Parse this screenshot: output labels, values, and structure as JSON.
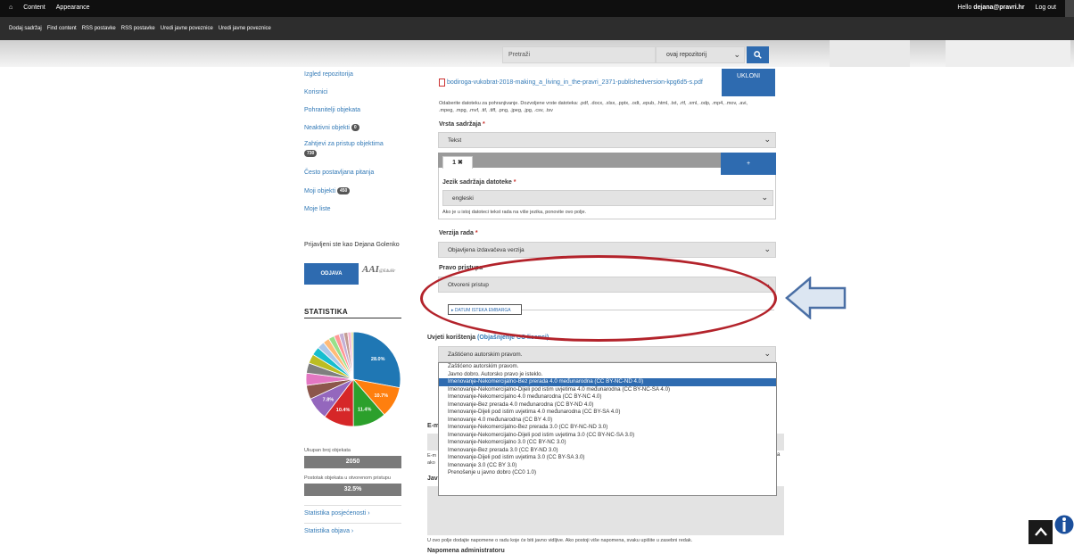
{
  "toolbar": {
    "content": "Content",
    "appearance": "Appearance",
    "hello": "Hello",
    "user": "dejana@pravri.hr",
    "logout": "Log out"
  },
  "shortcuts": [
    "Dodaj sadržaj",
    "Find content",
    "RSS postavke",
    "RSS postavke",
    "Uredi javne poveznice",
    "Uredi javne poveznice"
  ],
  "search": {
    "placeholder": "Pretraži",
    "scope": "ovaj repozitorij",
    "icon": "search-icon"
  },
  "sidebar": {
    "items": [
      {
        "label": "Izgled repozitorija"
      },
      {
        "label": "Korisnici"
      },
      {
        "label": "Pohranitelji objekata"
      },
      {
        "label": "Neaktivni objekti",
        "badge": "0"
      },
      {
        "label": "Zahtjevi za pristup objektima",
        "badge": "730"
      },
      {
        "label": "Često postavljana pitanja"
      },
      {
        "label": "Moji objekti",
        "badge": "450"
      },
      {
        "label": "Moje liste"
      }
    ],
    "logged_in": "Prijavljeni ste kao",
    "logged_user": "Dejana Golenko",
    "logout_button": "ODJAVA",
    "brand": "AAI",
    "brand_sub": "@EduHr"
  },
  "stats": {
    "title": "STATISTIKA",
    "total_label": "Ukupan broj objekata",
    "total_value": "2050",
    "open_label": "Postotak objekata u otvorenom pristupu",
    "open_value": "32.5%",
    "link_visits": "Statistika posjećenosti ›",
    "link_pubs": "Statistika objava ›"
  },
  "chart_data": {
    "type": "pie",
    "slices": [
      {
        "value": 28.0,
        "label": "28.0%",
        "color": "#1f77b4"
      },
      {
        "value": 10.7,
        "label": "10.7%",
        "color": "#ff7f0e"
      },
      {
        "value": 11.4,
        "label": "11.4%",
        "color": "#2ca02c"
      },
      {
        "value": 10.4,
        "label": "10.4%",
        "color": "#d62728"
      },
      {
        "value": 7.8,
        "label": "7.8%",
        "color": "#9467bd"
      },
      {
        "value": 4.8,
        "label": "",
        "color": "#8c564b"
      },
      {
        "value": 4.2,
        "label": "",
        "color": "#e377c2"
      },
      {
        "value": 3.5,
        "label": "",
        "color": "#7f7f7f"
      },
      {
        "value": 3.2,
        "label": "",
        "color": "#bcbd22"
      },
      {
        "value": 2.9,
        "label": "",
        "color": "#17becf"
      },
      {
        "value": 2.5,
        "label": "",
        "color": "#aec7e8"
      },
      {
        "value": 2.2,
        "label": "",
        "color": "#ffbb78"
      },
      {
        "value": 2.0,
        "label": "",
        "color": "#98df8a"
      },
      {
        "value": 1.8,
        "label": "",
        "color": "#ff9896"
      },
      {
        "value": 1.6,
        "label": "",
        "color": "#c5b0d5"
      },
      {
        "value": 1.4,
        "label": "",
        "color": "#c49c94"
      },
      {
        "value": 1.2,
        "label": "",
        "color": "#f7b6d2"
      },
      {
        "value": 0.7,
        "label": "",
        "color": "#dbdb8d"
      }
    ]
  },
  "form": {
    "file_name": "bodiroga-vukobrat-2018-making_a_living_in_the-pravri_2371-publishedversion-kpg6d5-s.pdf",
    "remove_button": "UKLONI",
    "file_help_1": "Odaberite datoteku za pohranjivanje. Dozvoljene vrste datoteka: .pdf, .docx, .xlsx, .pptx, .odt, .epub, .html, .txt, .rtf, .xml, .odp, .mp4, .mov, .avi,",
    "file_help_2": ".mpeg, .mpg, .mvf, .tif, .tiff, .png, .jpeg, .jpg, .csv, .tsv",
    "content_type_label": "Vrsta sadržaja",
    "content_type_value": "Tekst",
    "tab_label": "1",
    "add_tab": "+",
    "language_label": "Jezik sadržaja datoteke",
    "language_value": "engleski",
    "language_help": "Ako je u istoj datoteci tekst rada na više jezika, ponovite ovo polje.",
    "version_label": "Verzija rada",
    "version_value": "Objavljena izdavačeva verzija",
    "access_label": "Pravo pristupa",
    "access_value": "Otvoreni pristup",
    "embargo_button": "▸ DATUM ISTEKA EMBARGA",
    "terms_label": "Uvjeti korištenja",
    "terms_link": "(Objašnjenje CC licenci)",
    "terms_value": "Zaštićeno autorskim pravom.",
    "email_label": "E-m",
    "email_help_1": "E-m",
    "email_help_2": "ako",
    "public_label": "Jav",
    "public_help": "U ovo polje dodajte napomene o radu koje će biti javno vidljive. Ako postoji više napomena, svaku upišite u zasebni redak.",
    "admin_note_label": "Napomena administratoru"
  },
  "license_options": [
    "Zaštićeno autorskim pravom.",
    "Javno dobro. Autorsko pravo je isteklo.",
    "Imenovanje-Nekomercijalno-Bez prerada 4.0 međunarodna (CC BY-NC-ND 4.0)",
    "Imenovanje-Nekomercijalno-Dijeli pod istim uvjetima 4.0 međunarodna (CC BY-NC-SA 4.0)",
    "Imenovanje-Nekomercijalno 4.0 međunarodna (CC BY-NC 4.0)",
    "Imenovanje-Bez prerada 4.0 međunarodna (CC BY-ND 4.0)",
    "Imenovanje-Dijeli pod istim uvjetima 4.0 međunarodna (CC BY-SA 4.0)",
    "Imenovanje 4.0 međunarodna (CC BY 4.0)",
    "Imenovanje-Nekomercijalno-Bez prerada 3.0 (CC BY-NC-ND 3.0)",
    "Imenovanje-Nekomercijalno-Dijeli pod istim uvjetima 3.0 (CC BY-NC-SA 3.0)",
    "Imenovanje-Nekomercijalno 3.0 (CC BY-NC 3.0)",
    "Imenovanje-Bez prerada 3.0 (CC BY-ND 3.0)",
    "Imenovanje-Dijeli pod istim uvjetima 3.0 (CC BY-SA 3.0)",
    "Imenovanje 3.0 (CC BY 3.0)",
    "Prenošenje u javno dobro (CC0 1.0)"
  ],
  "selected_option_index": 2,
  "colors": {
    "accent": "#2e6bb0",
    "annotation_red": "#b3232b",
    "arrow_fill": "#dce6f2",
    "arrow_stroke": "#4a6fa5"
  }
}
